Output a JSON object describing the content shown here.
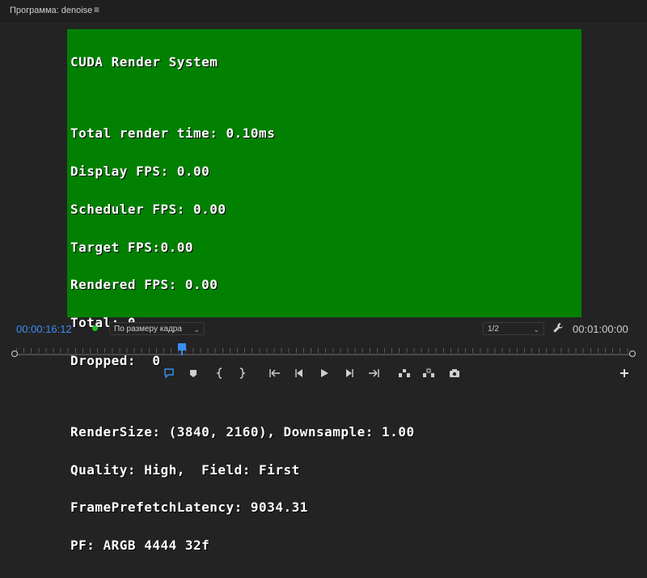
{
  "panel": {
    "title": "Программа: denoise",
    "menu_glyph": "≡"
  },
  "overlay": {
    "heading": "CUDA Render System",
    "stats": [
      "Total render time: 0.10ms",
      "Display FPS: 0.00",
      "Scheduler FPS: 0.00",
      "Target FPS:0.00",
      "Rendered FPS: 0.00",
      "Total: 0",
      "Dropped:  0"
    ],
    "info": [
      "RenderSize: (3840, 2160), Downsample: 1.00",
      "Quality: High,  Field: First",
      "FramePrefetchLatency: 9034.31",
      "PF: ARGB 4444 32f"
    ]
  },
  "viewer_bar": {
    "current_timecode": "00:00:16:12",
    "fit_option": "По размеру кадра",
    "resolution_option": "1/2",
    "duration_timecode": "00:01:00:00"
  },
  "timeline": {
    "playhead_fraction": 0.27
  },
  "controls": {
    "icons": [
      "comment-marker-icon",
      "add-marker-icon",
      "mark-in-icon",
      "mark-out-icon",
      "go-to-in-icon",
      "step-back-icon",
      "play-icon",
      "step-forward-icon",
      "go-to-out-icon",
      "lift-icon",
      "extract-icon",
      "export-frame-icon",
      "add-button-icon"
    ]
  },
  "colors": {
    "viewer_background": "#018001",
    "accent_blue": "#3a8ef0",
    "status_green": "#1fbf1f"
  }
}
